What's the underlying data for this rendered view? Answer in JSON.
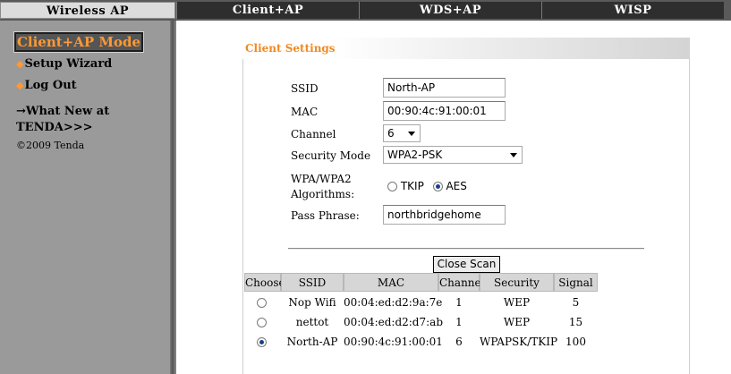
{
  "tabs": [
    {
      "label": "Wireless AP",
      "active": true
    },
    {
      "label": "Client+AP",
      "active": false
    },
    {
      "label": "WDS+AP",
      "active": false
    },
    {
      "label": "WISP",
      "active": false
    }
  ],
  "sidebar": {
    "mode_badge": "Client+AP Mode",
    "links": [
      "Setup Wizard",
      "Log Out"
    ],
    "whats_new_line1": "→What New at",
    "whats_new_line2": "TENDA>>>",
    "copyright": "©2009 Tenda"
  },
  "client_settings": {
    "title": "Client Settings",
    "ssid_label": "SSID",
    "ssid_value": "North-AP",
    "mac_label": "MAC",
    "mac_value": "00:90:4c:91:00:01",
    "channel_label": "Channel",
    "channel_value": "6",
    "security_mode_label": "Security Mode",
    "security_mode_value": "WPA2-PSK",
    "algorithms_label_line1": "WPA/WPA2",
    "algorithms_label_line2": "Algorithms:",
    "algorithm_options": [
      {
        "label": "TKIP",
        "selected": false
      },
      {
        "label": "AES",
        "selected": true
      }
    ],
    "pass_phrase_label": "Pass Phrase:",
    "pass_phrase_value": "northbridgehome"
  },
  "scan": {
    "button_label": "Close Scan",
    "columns": [
      "Choose",
      "SSID",
      "MAC",
      "Channel",
      "Security",
      "Signal"
    ],
    "rows": [
      {
        "selected": false,
        "ssid": "Nop Wifi",
        "mac": "00:04:ed:d2:9a:7e",
        "channel": "1",
        "security": "WEP",
        "signal": "5"
      },
      {
        "selected": false,
        "ssid": "nettot",
        "mac": "00:04:ed:d2:d7:ab",
        "channel": "1",
        "security": "WEP",
        "signal": "15"
      },
      {
        "selected": true,
        "ssid": "North-AP",
        "mac": "00:90:4c:91:00:01",
        "channel": "6",
        "security": "WPAPSK/TKIP",
        "signal": "100"
      }
    ]
  },
  "colors": {
    "accent": "#f08a24",
    "sidebar": "#9a9a9a",
    "tab_bar": "#2e2e2e"
  }
}
